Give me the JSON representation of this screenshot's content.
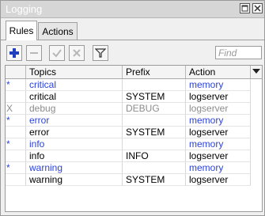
{
  "window": {
    "title": "Logging"
  },
  "tabs": [
    {
      "label": "Rules"
    },
    {
      "label": "Actions"
    }
  ],
  "search": {
    "placeholder": "Find"
  },
  "table": {
    "columns": [
      "",
      "Topics",
      "Prefix",
      "Action"
    ],
    "rows": [
      {
        "flag": "*",
        "topics": "critical",
        "prefix": "",
        "action": "memory"
      },
      {
        "flag": "",
        "topics": "critical",
        "prefix": "SYSTEM",
        "action": "logserver"
      },
      {
        "flag": "X",
        "topics": "debug",
        "prefix": "DEBUG",
        "action": "logserver"
      },
      {
        "flag": "*",
        "topics": "error",
        "prefix": "",
        "action": "memory"
      },
      {
        "flag": "",
        "topics": "error",
        "prefix": "SYSTEM",
        "action": "logserver"
      },
      {
        "flag": "*",
        "topics": "info",
        "prefix": "",
        "action": "memory"
      },
      {
        "flag": "",
        "topics": "info",
        "prefix": "INFO",
        "action": "logserver"
      },
      {
        "flag": "*",
        "topics": "warning",
        "prefix": "",
        "action": "memory"
      },
      {
        "flag": "",
        "topics": "warning",
        "prefix": "SYSTEM",
        "action": "logserver"
      }
    ]
  },
  "colors": {
    "default_rule_text": "#2e44d6",
    "disabled_text": "#8c8c8c",
    "add_icon": "#1f3fbf",
    "titlebar": "#d6d6d6"
  },
  "icons": [
    "restore-icon",
    "close-icon",
    "plus-icon",
    "minus-icon",
    "check-icon",
    "cross-icon",
    "filter-icon",
    "sort-dropdown-icon"
  ]
}
